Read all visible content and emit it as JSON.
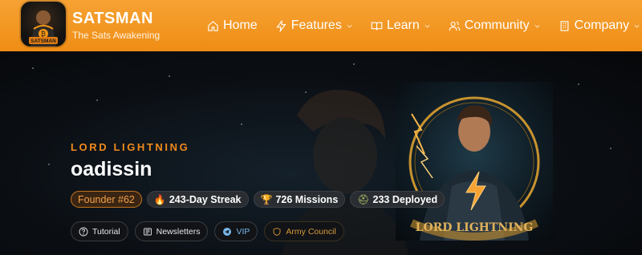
{
  "brand": {
    "title": "SATSMAN",
    "subtitle": "The Sats Awakening"
  },
  "nav": [
    {
      "label": "Home",
      "icon": "home-icon",
      "dropdown": false
    },
    {
      "label": "Features",
      "icon": "bolt-icon",
      "dropdown": true
    },
    {
      "label": "Learn",
      "icon": "book-icon",
      "dropdown": true
    },
    {
      "label": "Community",
      "icon": "users-icon",
      "dropdown": true
    },
    {
      "label": "Company",
      "icon": "building-icon",
      "dropdown": true
    }
  ],
  "profile": {
    "title": "LORD LIGHTNING",
    "username": "oadissin",
    "badges": {
      "founder": "Founder #62",
      "streak": "243-Day Streak",
      "missions": "726 Missions",
      "deployed": "233 Deployed"
    },
    "actions": {
      "tutorial": "Tutorial",
      "newsletters": "Newsletters",
      "vip": "VIP",
      "army": "Army Council"
    }
  },
  "colors": {
    "header": "#f29616",
    "accent": "#f08a1c",
    "vip": "#79b7e8",
    "army": "#d99a3a"
  }
}
